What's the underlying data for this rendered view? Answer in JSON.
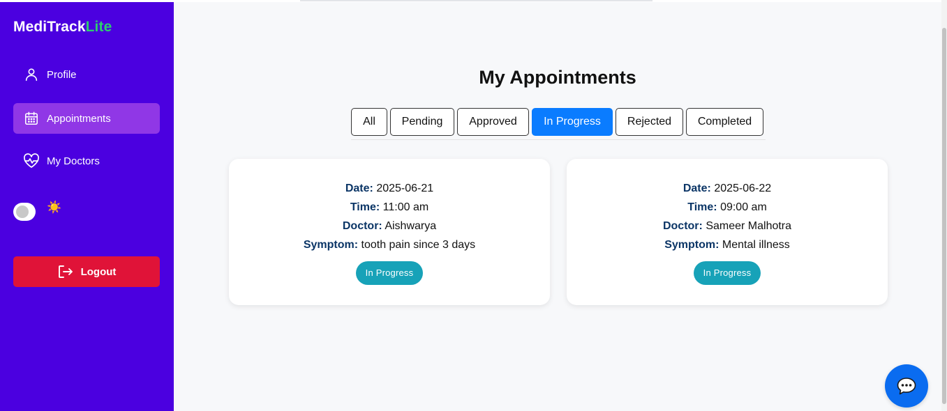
{
  "brand": {
    "name_main": "MediTrack",
    "name_accent": "Lite",
    "accent_color": "#2ecc71"
  },
  "sidebar": {
    "background": "#4b00e0",
    "items": [
      {
        "label": "Profile",
        "icon": "user-icon",
        "active": false
      },
      {
        "label": "Appointments",
        "icon": "calendar-icon",
        "active": true
      },
      {
        "label": "My Doctors",
        "icon": "heart-pulse-icon",
        "active": false
      }
    ],
    "theme_toggle": {
      "icon": "sun-icon",
      "glyph": "☀️"
    },
    "logout_label": "Logout"
  },
  "main": {
    "title": "My Appointments",
    "tabs": [
      {
        "label": "All",
        "active": false
      },
      {
        "label": "Pending",
        "active": false
      },
      {
        "label": "Approved",
        "active": false
      },
      {
        "label": "In Progress",
        "active": true
      },
      {
        "label": "Rejected",
        "active": false
      },
      {
        "label": "Completed",
        "active": false
      }
    ],
    "labels": {
      "date": "Date:",
      "time": "Time:",
      "doctor": "Doctor:",
      "symptom": "Symptom:"
    },
    "appointments": [
      {
        "date": "2025-06-21",
        "time": "11:00 am",
        "doctor": "Aishwarya",
        "symptom": "tooth pain since 3 days",
        "status": "In Progress"
      },
      {
        "date": "2025-06-22",
        "time": "09:00 am",
        "doctor": "Sameer Malhotra",
        "symptom": "Mental illness",
        "status": "In Progress"
      }
    ]
  },
  "chat_button": {
    "icon": "chat-bubble-icon"
  }
}
